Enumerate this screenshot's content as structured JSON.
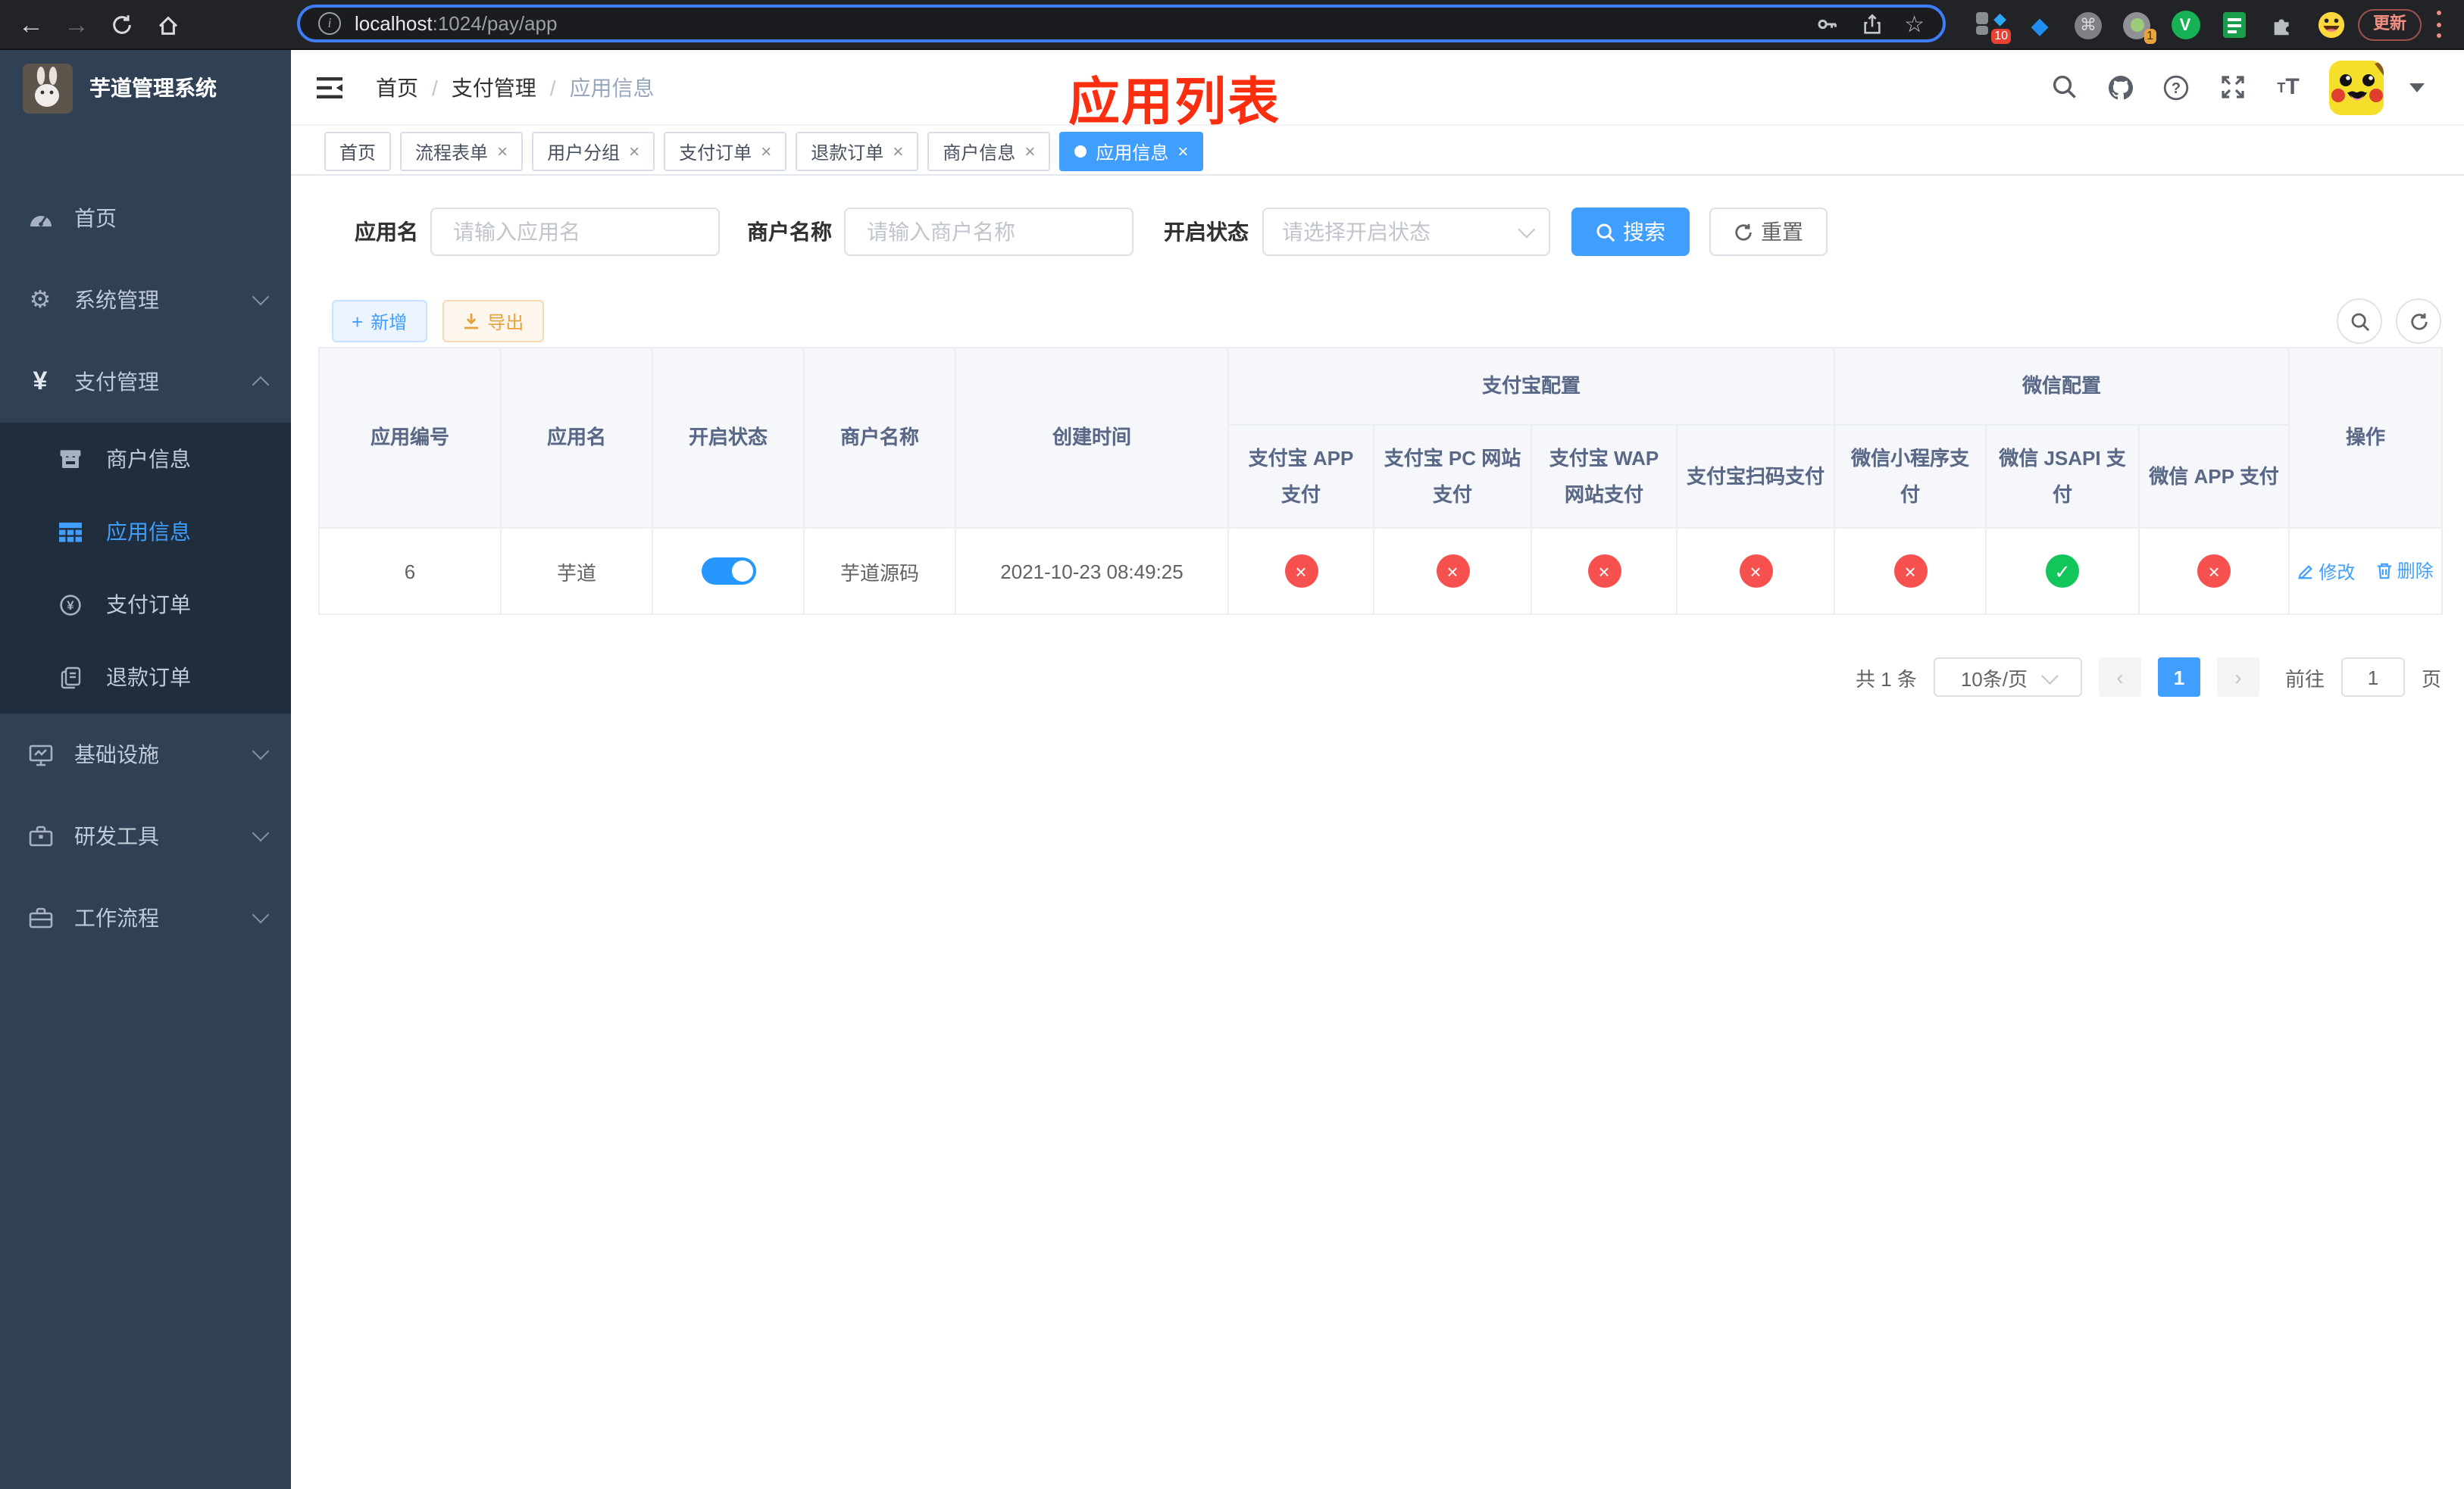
{
  "browser": {
    "url_host": "localhost",
    "url_path": ":1024/pay/app",
    "update_label": "更新",
    "ext_badge_count": "10",
    "ext_circle_badge": "1",
    "ext_v_letter": "V"
  },
  "icons": {
    "close": "×",
    "plus": "+",
    "check": "✓",
    "cross": "×",
    "star": "☆",
    "back": "←",
    "forward": "→",
    "command": "⌘",
    "diamond": "◆",
    "yen": "¥",
    "gear": "⚙"
  },
  "sidebar": {
    "title": "芋道管理系统",
    "items": [
      {
        "label": "首页"
      },
      {
        "label": "系统管理"
      },
      {
        "label": "支付管理"
      },
      {
        "label": "商户信息"
      },
      {
        "label": "应用信息"
      },
      {
        "label": "支付订单"
      },
      {
        "label": "退款订单"
      },
      {
        "label": "基础设施"
      },
      {
        "label": "研发工具"
      },
      {
        "label": "工作流程"
      }
    ]
  },
  "header": {
    "breadcrumb": [
      "首页",
      "支付管理",
      "应用信息"
    ],
    "separator": "/",
    "overlay_title": "应用列表"
  },
  "tabs": [
    {
      "label": "首页"
    },
    {
      "label": "流程表单"
    },
    {
      "label": "用户分组"
    },
    {
      "label": "支付订单"
    },
    {
      "label": "退款订单"
    },
    {
      "label": "商户信息"
    },
    {
      "label": "应用信息"
    }
  ],
  "filters": {
    "app_name_label": "应用名",
    "app_name_placeholder": "请输入应用名",
    "merchant_label": "商户名称",
    "merchant_placeholder": "请输入商户名称",
    "status_label": "开启状态",
    "status_placeholder": "请选择开启状态",
    "search_label": "搜索",
    "reset_label": "重置"
  },
  "toolbar": {
    "add_label": "新增",
    "export_label": "导出"
  },
  "table": {
    "columns": {
      "id": "应用编号",
      "name": "应用名",
      "status": "开启状态",
      "merchant": "商户名称",
      "created": "创建时间",
      "actions": "操作"
    },
    "groups": {
      "alipay": {
        "label": "支付宝配置",
        "cols": [
          "支付宝 APP 支付",
          "支付宝 PC 网站支付",
          "支付宝 WAP 网站支付",
          "支付宝扫码支付"
        ]
      },
      "wechat": {
        "label": "微信配置",
        "cols": [
          "微信小程序支付",
          "微信 JSAPI 支付",
          "微信 APP 支付"
        ]
      }
    },
    "row": {
      "id": "6",
      "name": "芋道",
      "enabled": true,
      "merchant": "芋道源码",
      "created": "2021-10-23 08:49:25",
      "statuses": [
        false,
        false,
        false,
        false,
        false,
        true,
        false
      ],
      "edit_label": "修改",
      "delete_label": "删除"
    }
  },
  "pagination": {
    "total": "共 1 条",
    "page_size": "10条/页",
    "current_page": "1",
    "goto_label": "前往",
    "goto_value": "1",
    "page_unit": "页"
  }
}
